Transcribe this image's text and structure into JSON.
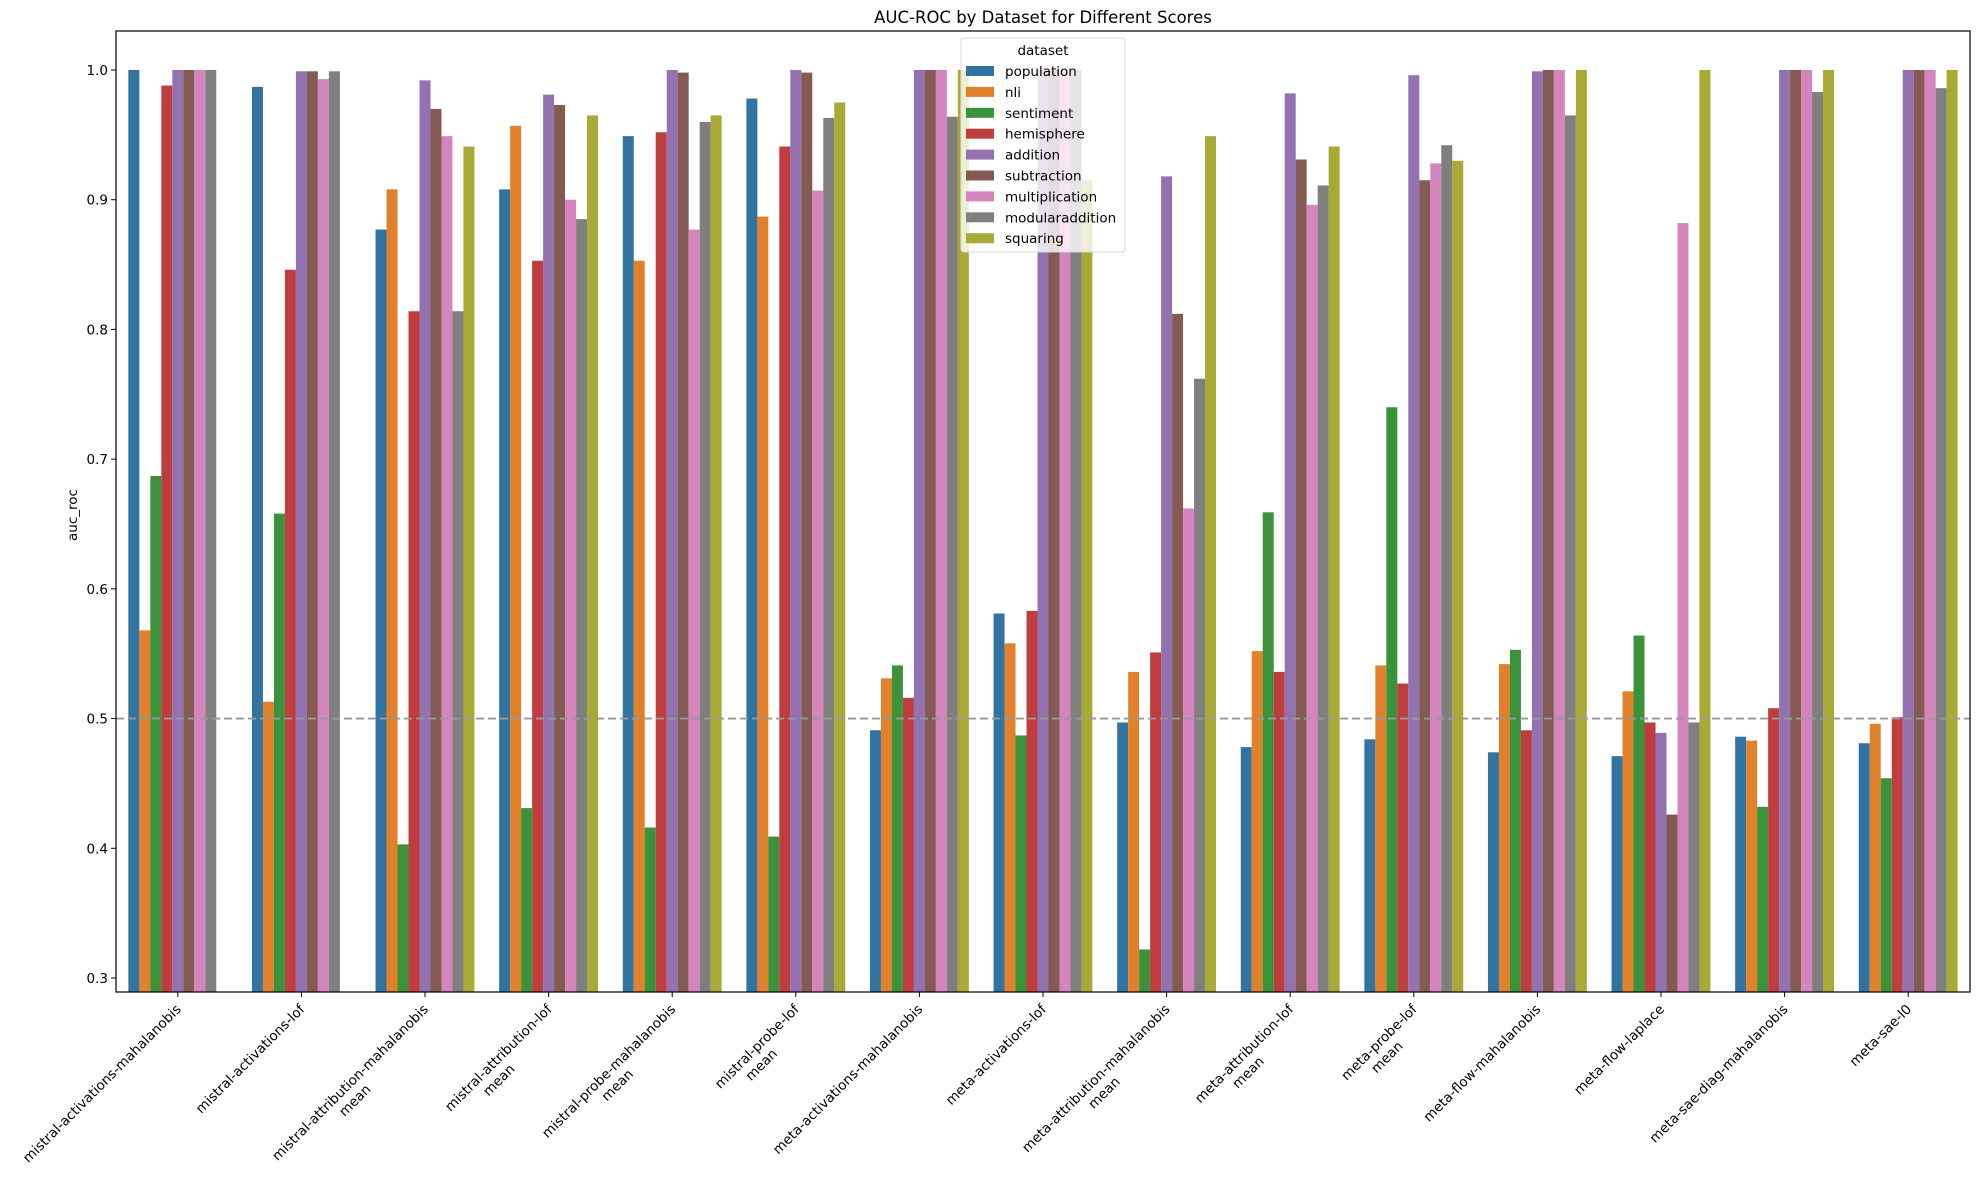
{
  "chart_data": {
    "type": "bar",
    "title": "AUC-ROC by Dataset for Different Scores",
    "xlabel": "",
    "ylabel": "auc_roc",
    "ylim": [
      0.288,
      1.033
    ],
    "yticks": [
      "0.3",
      "0.4",
      "0.5",
      "0.6",
      "0.7",
      "0.8",
      "0.9",
      "1.0"
    ],
    "ytick_values": [
      0.3,
      0.4,
      0.5,
      0.6,
      0.7,
      0.8,
      0.9,
      1.0
    ],
    "reference_line": {
      "y": 0.5,
      "style": "dashed",
      "color": "#999999"
    },
    "grid": false,
    "legend": {
      "title": "dataset",
      "placement": "top-center"
    },
    "categories": [
      [
        "mistral-activations-mahalanobis"
      ],
      [
        "mistral-activations-lof"
      ],
      [
        "mistral-attribution-mahalanobis",
        "mean"
      ],
      [
        "mistral-attribution-lof",
        "mean"
      ],
      [
        "mistral-probe-mahalanobis",
        "mean"
      ],
      [
        "mistral-probe-lof",
        "mean"
      ],
      [
        "meta-activations-mahalanobis"
      ],
      [
        "meta-activations-lof"
      ],
      [
        "meta-attribution-mahalanobis",
        "mean"
      ],
      [
        "meta-attribution-lof",
        "mean"
      ],
      [
        "meta-probe-lof",
        "mean"
      ],
      [
        "meta-flow-mahalanobis"
      ],
      [
        "meta-flow-laplace"
      ],
      [
        "meta-sae-diag-mahalanobis"
      ],
      [
        "meta-sae-l0"
      ]
    ],
    "series": [
      {
        "name": "population",
        "color": "#3274a1",
        "values": [
          1.0,
          0.987,
          0.877,
          0.908,
          0.949,
          0.978,
          0.491,
          0.581,
          0.497,
          0.478,
          0.484,
          0.474,
          0.471,
          0.486,
          0.481
        ]
      },
      {
        "name": "nli",
        "color": "#e1812c",
        "values": [
          0.568,
          0.513,
          0.908,
          0.957,
          0.853,
          0.887,
          0.531,
          0.558,
          0.536,
          0.552,
          0.541,
          0.542,
          0.521,
          0.483,
          0.496
        ]
      },
      {
        "name": "sentiment",
        "color": "#3a923a",
        "values": [
          0.687,
          0.658,
          0.403,
          0.431,
          0.416,
          0.409,
          0.541,
          0.487,
          0.322,
          0.659,
          0.74,
          0.553,
          0.564,
          0.432,
          0.454
        ]
      },
      {
        "name": "hemisphere",
        "color": "#c03d3e",
        "values": [
          0.988,
          0.846,
          0.814,
          0.853,
          0.952,
          0.941,
          0.516,
          0.583,
          0.551,
          0.536,
          0.527,
          0.491,
          0.497,
          0.508,
          0.501
        ]
      },
      {
        "name": "addition",
        "color": "#9372b2",
        "values": [
          1.0,
          0.999,
          0.992,
          0.981,
          1.0,
          1.0,
          1.0,
          1.0,
          0.918,
          0.982,
          0.996,
          0.999,
          0.489,
          1.0,
          1.0
        ]
      },
      {
        "name": "subtraction",
        "color": "#845b53",
        "values": [
          1.0,
          0.999,
          0.97,
          0.973,
          0.998,
          0.998,
          1.0,
          1.0,
          0.812,
          0.931,
          0.915,
          1.0,
          0.426,
          1.0,
          1.0
        ]
      },
      {
        "name": "multiplication",
        "color": "#d684bd",
        "values": [
          1.0,
          0.993,
          0.949,
          0.9,
          0.877,
          0.907,
          1.0,
          1.0,
          0.662,
          0.896,
          0.928,
          1.0,
          0.882,
          1.0,
          1.0
        ]
      },
      {
        "name": "modularaddition",
        "color": "#7f7f7f",
        "values": [
          1.0,
          0.999,
          0.814,
          0.885,
          0.96,
          0.963,
          0.964,
          1.0,
          0.762,
          0.911,
          0.942,
          0.965,
          0.497,
          0.983,
          0.986
        ]
      },
      {
        "name": "squaring",
        "color": "#a9aa35",
        "values": [
          null,
          null,
          0.941,
          0.965,
          0.965,
          0.975,
          1.0,
          0.915,
          0.949,
          0.941,
          0.93,
          1.0,
          1.0,
          1.0,
          1.0
        ]
      }
    ]
  }
}
